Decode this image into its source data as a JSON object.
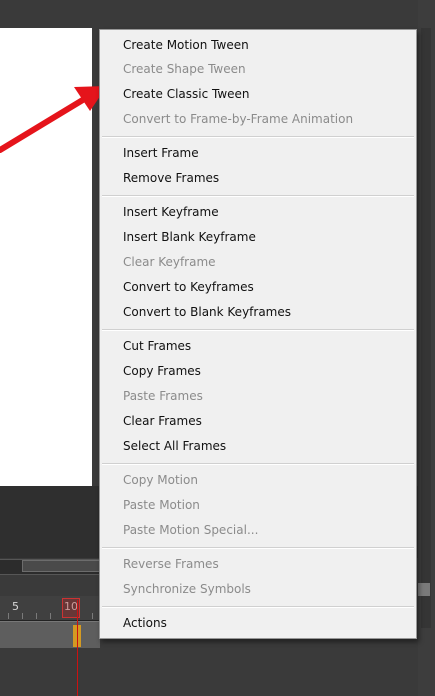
{
  "colors": {
    "menu_bg": "#f0f0f0",
    "menu_border": "#979797",
    "enabled_text": "#111111",
    "disabled_text": "#8b8b8b",
    "arrow": "#e5141b",
    "playhead": "#cc1111",
    "keyframe": "#d49a22"
  },
  "timeline": {
    "labels": [
      "5",
      "10"
    ]
  },
  "context_menu": {
    "items": [
      {
        "label": "Create Motion Tween",
        "enabled": true
      },
      {
        "label": "Create Shape Tween",
        "enabled": false
      },
      {
        "label": "Create Classic Tween",
        "enabled": true
      },
      {
        "label": "Convert to Frame-by-Frame Animation",
        "enabled": false
      },
      {
        "label": "Insert Frame",
        "enabled": true
      },
      {
        "label": "Remove Frames",
        "enabled": true
      },
      {
        "label": "Insert Keyframe",
        "enabled": true
      },
      {
        "label": "Insert Blank Keyframe",
        "enabled": true
      },
      {
        "label": "Clear Keyframe",
        "enabled": false
      },
      {
        "label": "Convert to Keyframes",
        "enabled": true
      },
      {
        "label": "Convert to Blank Keyframes",
        "enabled": true
      },
      {
        "label": "Cut Frames",
        "enabled": true
      },
      {
        "label": "Copy Frames",
        "enabled": true
      },
      {
        "label": "Paste Frames",
        "enabled": false
      },
      {
        "label": "Clear Frames",
        "enabled": true
      },
      {
        "label": "Select All Frames",
        "enabled": true
      },
      {
        "label": "Copy Motion",
        "enabled": false
      },
      {
        "label": "Paste Motion",
        "enabled": false
      },
      {
        "label": "Paste Motion Special...",
        "enabled": false
      },
      {
        "label": "Reverse Frames",
        "enabled": false
      },
      {
        "label": "Synchronize Symbols",
        "enabled": false
      },
      {
        "label": "Actions",
        "enabled": true
      }
    ]
  }
}
